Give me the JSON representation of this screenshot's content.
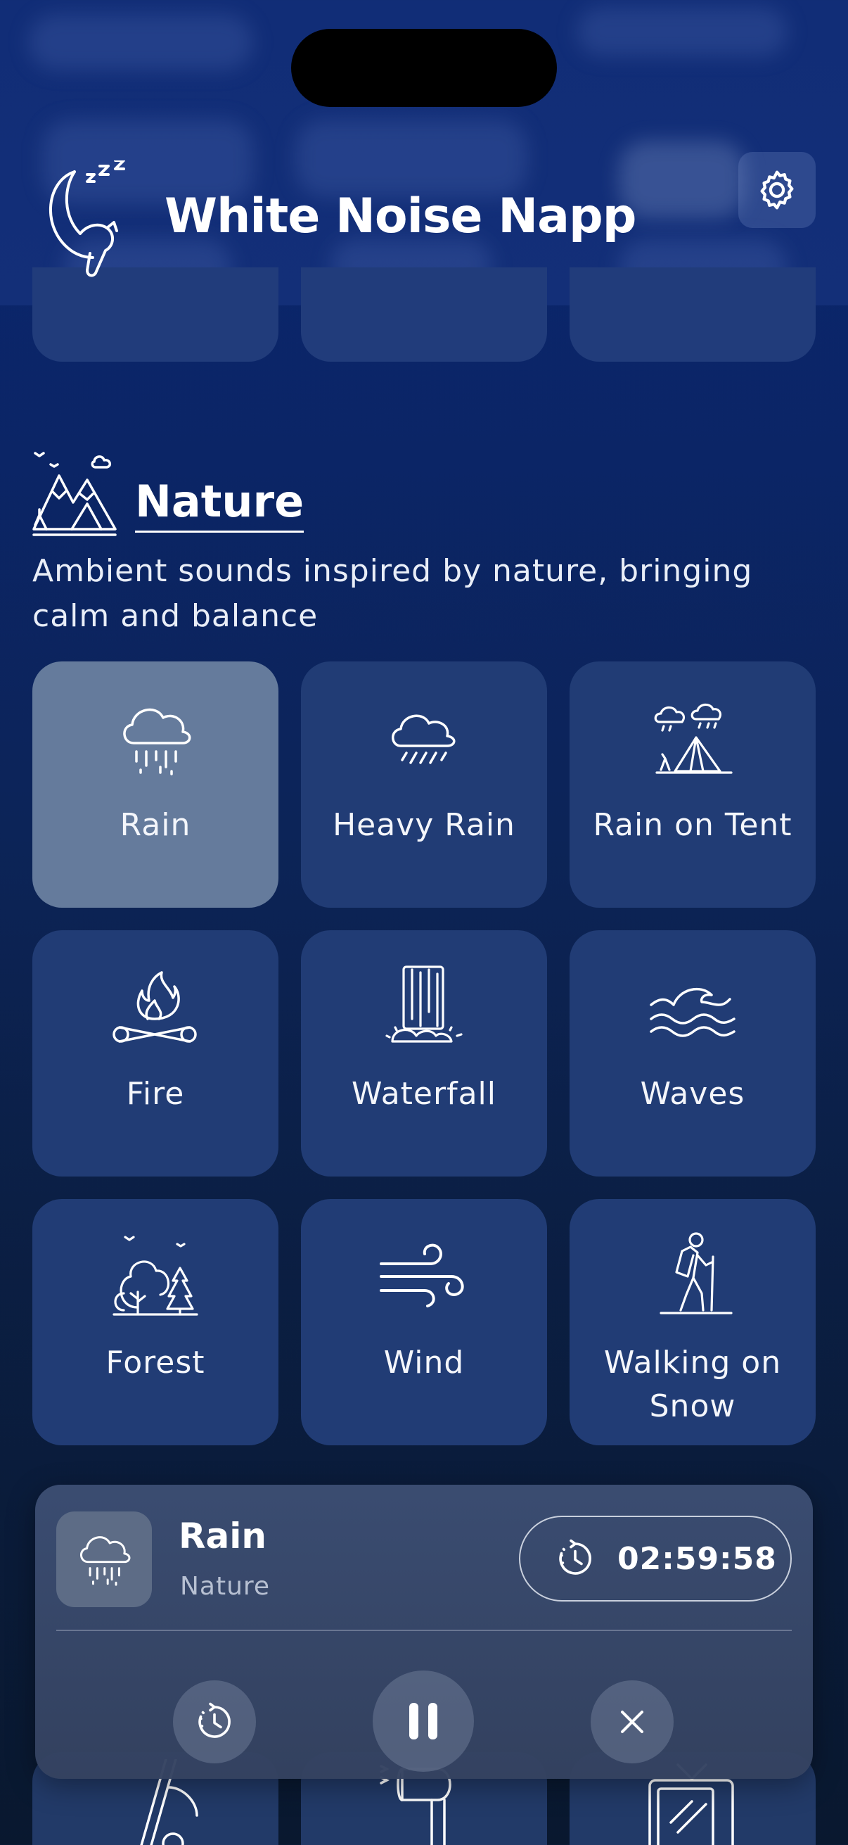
{
  "app": {
    "title": "White Noise Napp"
  },
  "section": {
    "title": "Nature",
    "description": "Ambient sounds inspired by nature, bringing calm and balance"
  },
  "sounds": [
    {
      "label": "Rain",
      "icon": "rain-cloud-icon",
      "selected": true
    },
    {
      "label": "Heavy Rain",
      "icon": "heavy-rain-icon",
      "selected": false
    },
    {
      "label": "Rain on Tent",
      "icon": "tent-rain-icon",
      "selected": false
    },
    {
      "label": "Fire",
      "icon": "campfire-icon",
      "selected": false
    },
    {
      "label": "Waterfall",
      "icon": "waterfall-icon",
      "selected": false
    },
    {
      "label": "Waves",
      "icon": "waves-icon",
      "selected": false
    },
    {
      "label": "Forest",
      "icon": "forest-icon",
      "selected": false
    },
    {
      "label": "Wind",
      "icon": "wind-icon",
      "selected": false
    },
    {
      "label": "Walking on Snow",
      "icon": "hiker-icon",
      "selected": false
    }
  ],
  "player": {
    "title": "Rain",
    "category": "Nature",
    "timer": "02:59:58",
    "icons": {
      "thumb": "rain-cloud-icon",
      "timer": "timer-icon",
      "timer_control": "timer-icon",
      "pause": "pause-icon",
      "close": "close-icon"
    }
  },
  "colors": {
    "background_top": "#0a2670",
    "card": "#213c75",
    "card_selected": "#657b9c",
    "player": "#3c4e73"
  }
}
